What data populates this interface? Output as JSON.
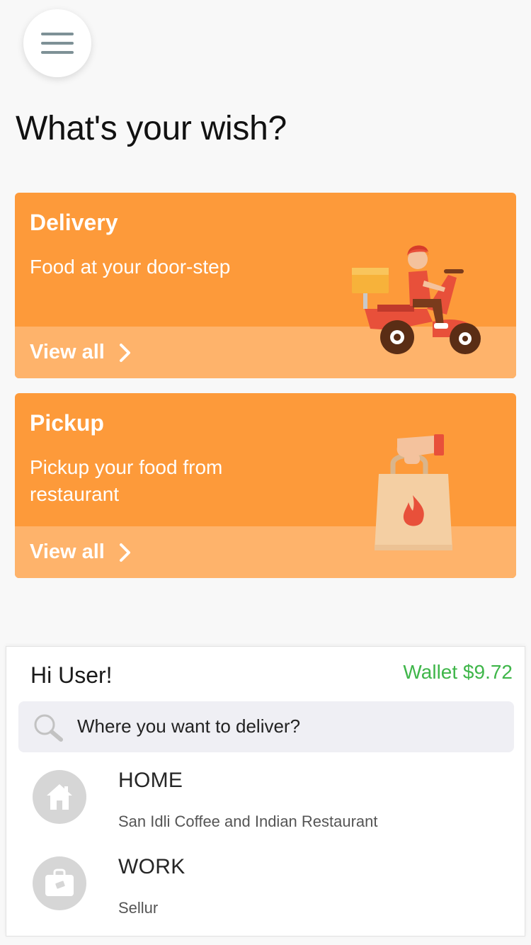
{
  "header": {
    "menu_icon": "hamburger-menu-icon",
    "title": "What's your wish?"
  },
  "cards": {
    "delivery": {
      "title": "Delivery",
      "subtitle": "Food at your door-step",
      "link": "View all",
      "illustration": "scooter-delivery-rider"
    },
    "pickup": {
      "title": "Pickup",
      "subtitle": "Pickup your food from restaurant",
      "link": "View all",
      "illustration": "hand-holding-food-bag"
    }
  },
  "panel": {
    "greeting": "Hi User!",
    "wallet": "Wallet $9.72",
    "search": {
      "placeholder": "Where you want to deliver?",
      "icon": "search-icon"
    },
    "addresses": [
      {
        "label": "HOME",
        "detail": "San Idli Coffee and Indian Restaurant",
        "icon": "home-icon"
      },
      {
        "label": "WORK",
        "detail": "Sellur",
        "icon": "briefcase-icon"
      }
    ]
  },
  "colors": {
    "card_orange": "#fd9a3a",
    "card_footer": "#feb36b",
    "wallet_green": "#3fb64a",
    "page_bg": "#f8f8f8"
  }
}
